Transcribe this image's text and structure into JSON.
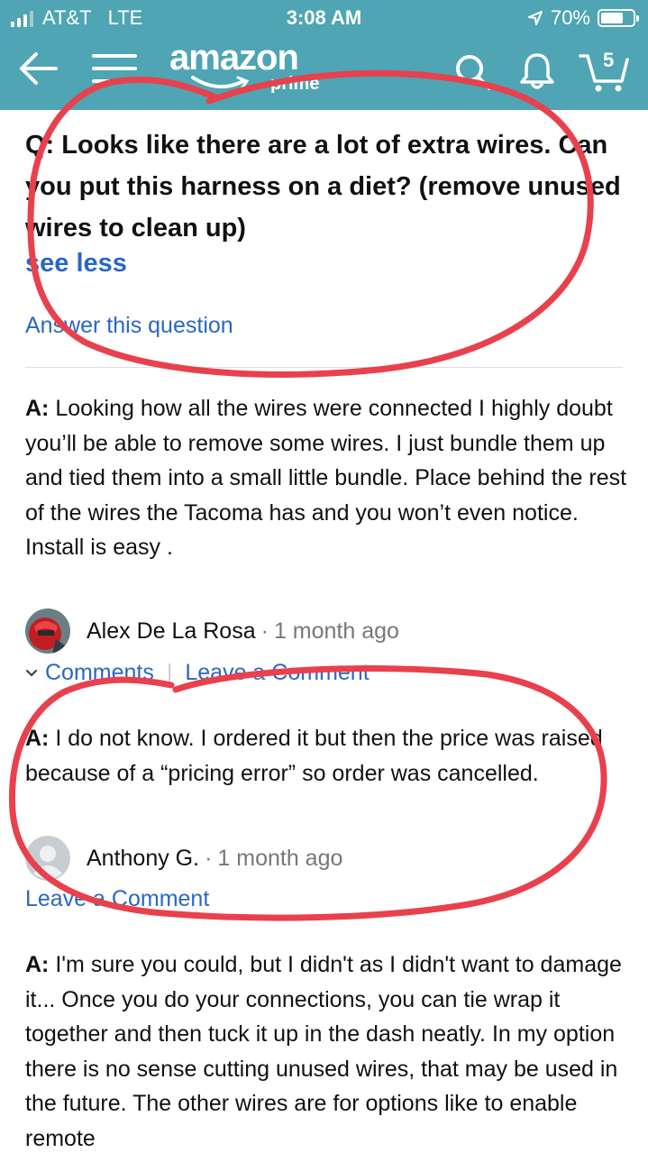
{
  "status_bar": {
    "carrier": "AT&T",
    "network": "LTE",
    "time": "3:08 AM",
    "battery_percent": "70%",
    "battery_level": 0.7
  },
  "nav": {
    "logo": "amazon",
    "logo_sub": "prime",
    "cart_count": "5"
  },
  "question": {
    "text": "Q: Looks like there are a lot of extra wires. Can you put this harness on a diet? (remove unused wires to clean up)",
    "see_less": "see less",
    "answer_link": "Answer this question"
  },
  "answers": [
    {
      "prefix": "A:",
      "text": " Looking how all the wires were connected I highly doubt you’ll be able to remove some wires. I just bundle them up and tied them into a small little bundle. Place behind the rest of the wires the Tacoma has and you won’t even notice. Install is easy .",
      "author": "Alex De La Rosa",
      "dot": "·",
      "ago": "1 month ago",
      "comments_link": "Comments",
      "leave_comment_link": "Leave a Comment"
    },
    {
      "prefix": "A:",
      "text": " I do not know. I ordered it but then the price was raised because of a “pricing error” so order was cancelled.",
      "author": "Anthony G.",
      "dot": "·",
      "ago": "1 month ago",
      "leave_comment_link": "Leave a Comment"
    },
    {
      "prefix": "A:",
      "text": " I'm sure you could, but I didn't as I didn't want to damage it... Once you do your connections, you can tie wrap it together and then tuck it up in the dash neatly. In my option there is no sense cutting unused wires, that may be used in the future. The other wires are for options like to enable remote"
    }
  ],
  "colors": {
    "brand_teal": "#4fa5b3",
    "link_blue": "#2a67c4",
    "annotation_red": "#e8414d"
  },
  "icons": [
    "back-arrow-icon",
    "menu-icon",
    "search-icon",
    "bell-icon",
    "cart-icon",
    "chevron-down-icon",
    "avatar-photo",
    "avatar-placeholder-icon"
  ]
}
